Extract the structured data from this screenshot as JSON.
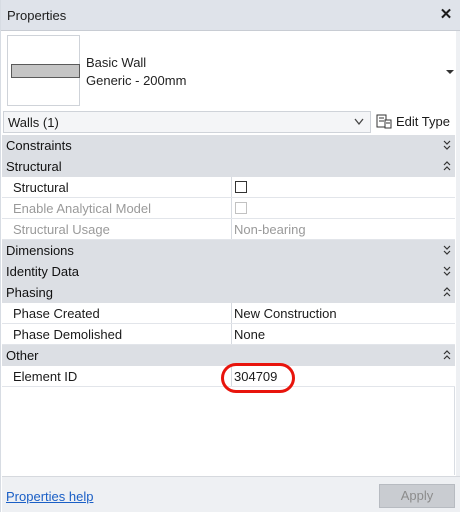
{
  "panel": {
    "title": "Properties",
    "close_glyph": "✕"
  },
  "type_selector": {
    "family": "Basic Wall",
    "type_name": "Generic - 200mm",
    "thumbnail_icon": "wall-thumbnail-icon"
  },
  "filter": {
    "value": "Walls (1)",
    "edit_type_label": "Edit Type"
  },
  "categories": {
    "constraints": {
      "label": "Constraints",
      "state": "collapsed"
    },
    "structural": {
      "label": "Structural",
      "state": "expanded"
    },
    "dimensions": {
      "label": "Dimensions",
      "state": "collapsed"
    },
    "identity_data": {
      "label": "Identity Data",
      "state": "collapsed"
    },
    "phasing": {
      "label": "Phasing",
      "state": "expanded"
    },
    "other": {
      "label": "Other",
      "state": "expanded"
    }
  },
  "properties": {
    "structural": {
      "name": "Structural",
      "checked": false
    },
    "enable_analytical_model": {
      "name": "Enable Analytical Model",
      "checked": false,
      "disabled": true
    },
    "structural_usage": {
      "name": "Structural Usage",
      "value": "Non-bearing",
      "disabled": true
    },
    "phase_created": {
      "name": "Phase Created",
      "value": "New Construction"
    },
    "phase_demolished": {
      "name": "Phase Demolished",
      "value": "None"
    },
    "element_id": {
      "name": "Element ID",
      "value": "304709"
    }
  },
  "footer": {
    "help_label": "Properties help",
    "apply_label": "Apply"
  },
  "colors": {
    "highlight_ring": "#e8140c",
    "category_bg": "#dcdfe4",
    "link": "#1a5fc6"
  }
}
